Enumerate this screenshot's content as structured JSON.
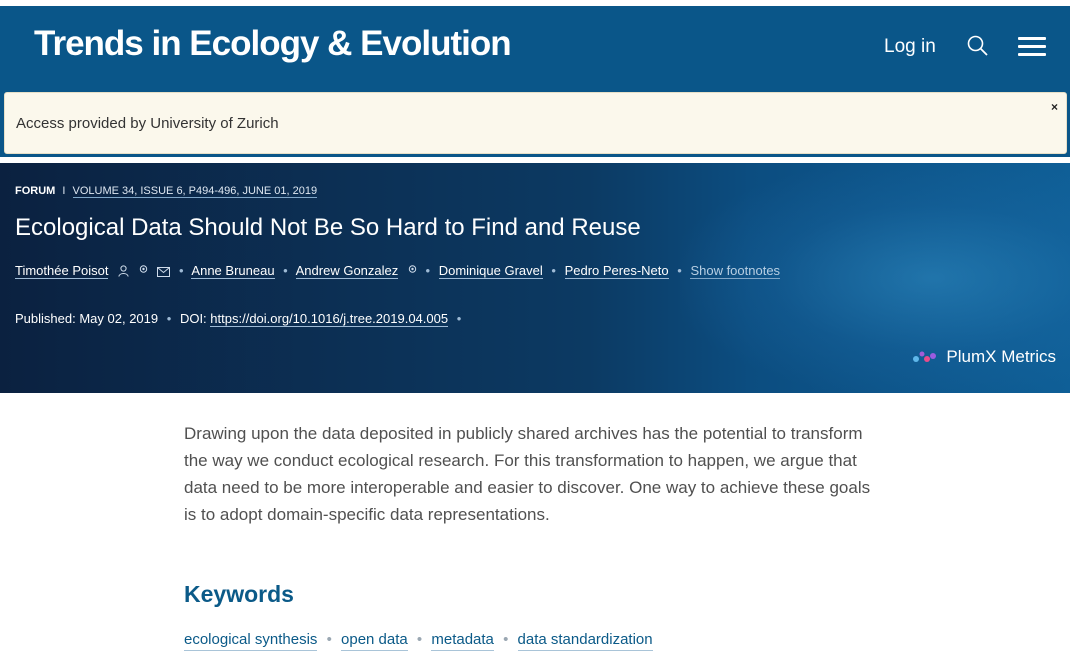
{
  "header": {
    "journal_title": "Trends in Ecology & Evolution",
    "login_label": "Log in",
    "search_icon": "search-icon",
    "menu_icon": "hamburger-menu-icon",
    "background_color": "#0a5689"
  },
  "notice": {
    "text": "Access provided by University of Zurich",
    "close_label": "×"
  },
  "article": {
    "section": "FORUM",
    "separator": "I",
    "volume_info": "VOLUME 34, ISSUE 6, P494-496, JUNE 01, 2019",
    "title": "Ecological Data Should Not Be So Hard to Find and Reuse",
    "authors": [
      "Timothée Poisot",
      "Anne Bruneau",
      "Andrew Gonzalez",
      "Dominique Gravel",
      "Pedro Peres-Neto"
    ],
    "show_footnotes_label": "Show footnotes",
    "published_label": "Published:",
    "published_date": "May 02, 2019",
    "doi_label": "DOI:",
    "doi_link": "https://doi.org/10.1016/j.tree.2019.04.005",
    "plumx_label": "PlumX Metrics"
  },
  "abstract": {
    "text": "Drawing upon the data deposited in publicly shared archives has the potential to transform the way we conduct ecological research. For this transformation to happen, we argue that data need to be more interoperable and easier to discover. One way to achieve these goals is to adopt domain-specific data representations."
  },
  "keywords": {
    "heading": "Keywords",
    "items": [
      "ecological synthesis",
      "open data",
      "metadata",
      "data standardization"
    ],
    "color": "#0b5a88"
  }
}
